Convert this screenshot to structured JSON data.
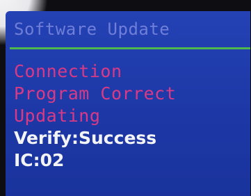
{
  "screen": {
    "title": "Software Update",
    "steps": [
      {
        "label": "Connection"
      },
      {
        "label": "Program Correct"
      },
      {
        "label": "Updating"
      }
    ],
    "verify_text": "Verify:Success",
    "ic_text": "IC:02"
  },
  "colors": {
    "screen_background": "#1f3aa8",
    "title_text": "#6f7ed8",
    "divider": "#4fb84a",
    "step_text": "#d83a86",
    "status_text": "#f3f4f8"
  }
}
